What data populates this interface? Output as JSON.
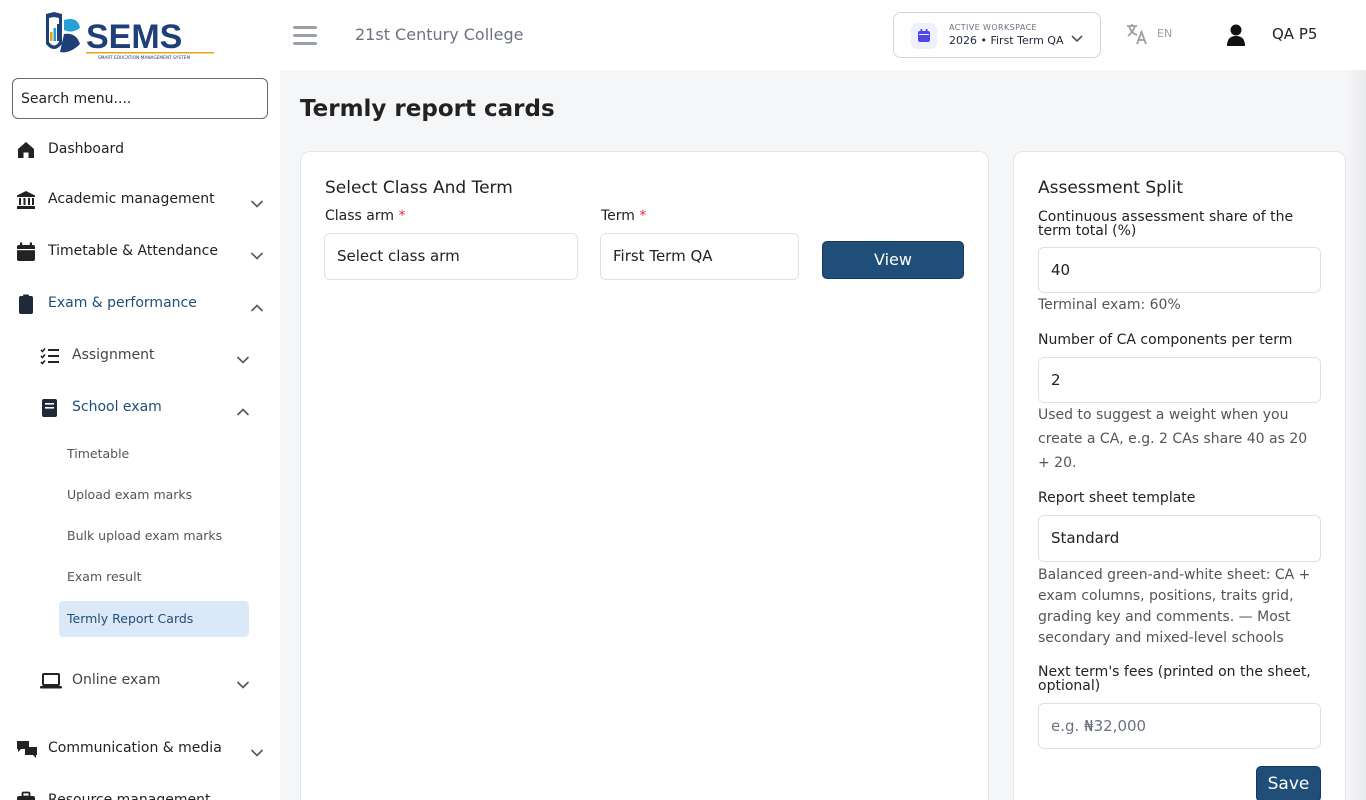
{
  "header": {
    "logo_text": "SEMS",
    "logo_tagline": "SMART EDUCATION MANAGEMENT SYSTEM",
    "school_name": "21st Century College",
    "workspace_label": "ACTIVE WORKSPACE",
    "workspace_value": "2026 • First Term QA",
    "language": "EN",
    "user_name": "QA P5"
  },
  "sidebar": {
    "search_placeholder": "Search menu....",
    "items": [
      {
        "label": "Dashboard",
        "icon": "home-icon"
      },
      {
        "label": "Academic management",
        "icon": "bank-icon"
      },
      {
        "label": "Timetable & Attendance",
        "icon": "calendar-icon"
      },
      {
        "label": "Exam & performance",
        "icon": "clipboard-icon"
      },
      {
        "label": "Assignment",
        "icon": "list-check-icon"
      },
      {
        "label": "School exam",
        "icon": "book-icon"
      },
      {
        "label": "Timetable"
      },
      {
        "label": "Upload exam marks"
      },
      {
        "label": "Bulk upload exam marks"
      },
      {
        "label": "Exam result"
      },
      {
        "label": "Termly Report Cards"
      },
      {
        "label": "Online exam",
        "icon": "laptop-icon"
      },
      {
        "label": "Communication & media",
        "icon": "chat-icon"
      },
      {
        "label": "Resource management",
        "icon": "briefcase-icon"
      }
    ]
  },
  "main": {
    "page_title": "Termly report cards",
    "select_card": {
      "title": "Select Class And Term",
      "class_arm_label": "Class arm",
      "class_arm_value": "Select class arm",
      "term_label": "Term",
      "term_value": "First Term QA",
      "required_mark": "*",
      "view_button": "View"
    },
    "assessment_card": {
      "title": "Assessment Split",
      "ca_share_label": "Continuous assessment share of the term total (%)",
      "ca_share_value": "40",
      "terminal_exam_text": "Terminal exam: 60%",
      "ca_components_label": "Number of CA components per term",
      "ca_components_value": "2",
      "ca_components_help": "Used to suggest a weight when you create a CA, e.g. 2 CAs share 40 as 20 + 20.",
      "template_label": "Report sheet template",
      "template_value": "Standard",
      "template_help": "Balanced green-and-white sheet: CA + exam columns, positions, traits grid, grading key and comments. — Most secondary and mixed-level schools",
      "fees_label": "Next term's fees (printed on the sheet, optional)",
      "fees_placeholder": "e.g. ₦32,000",
      "save_button": "Save"
    }
  }
}
